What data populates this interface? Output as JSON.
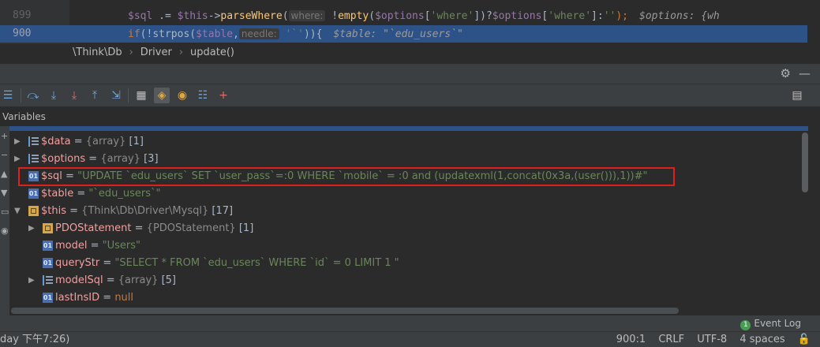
{
  "editor": {
    "lines": [
      {
        "number": "899"
      },
      {
        "number": "900"
      }
    ],
    "line899": {
      "code_a": "$sql",
      "code_b": " .= ",
      "code_c": "$this",
      "code_d": "->",
      "code_e": "parseWhere",
      "code_f": "(",
      "hint": "where:",
      "code_g": " !",
      "code_h": "empty",
      "code_i": "(",
      "code_j": "$options",
      "code_k": "[",
      "code_l": "'where'",
      "code_m": "])?",
      "code_n": "$options",
      "code_o": "[",
      "code_p": "'where'",
      "code_q": "]:",
      "code_r": "''",
      "code_s": ");",
      "inline": "$options: {wh"
    },
    "line900": {
      "code_a": "if",
      "code_b": "(!",
      "code_c": "strpos",
      "code_d": "(",
      "code_e": "$table",
      "code_f": ",",
      "hint": "needle:",
      "code_g": " '`'",
      "code_h": ")){",
      "inline": "$table: \"`edu_users`\""
    }
  },
  "breadcrumb": {
    "items": [
      "\\Think\\Db",
      "Driver",
      "update()"
    ]
  },
  "debug": {
    "section_label": "Variables",
    "header_icons": [
      "gear-icon",
      "minimize-icon"
    ],
    "variables": [
      {
        "name": "$data",
        "type": "{array}",
        "count": "[1]"
      },
      {
        "name": "$options",
        "type": "{array}",
        "count": "[3]"
      },
      {
        "name": "$sql",
        "value": "\"UPDATE `edu_users` SET `user_pass`=:0 WHERE `mobile` = :0 and (updatexml(1,concat(0x3a,(user())),1))#\""
      },
      {
        "name": "$table",
        "value": "\"`edu_users`\""
      },
      {
        "name": "$this",
        "type": "{Think\\Db\\Driver\\Mysql}",
        "count": "[17]"
      },
      {
        "name": "PDOStatement",
        "type": "{PDOStatement}",
        "count": "[1]"
      },
      {
        "name": "model",
        "value": "\"Users\""
      },
      {
        "name": "queryStr",
        "value": "\"SELECT * FROM `edu_users` WHERE `id` = 0 LIMIT 1  \""
      },
      {
        "name": "modelSql",
        "type": "{array}",
        "count": "[5]"
      },
      {
        "name": "lastInsID",
        "value": "null"
      }
    ],
    "eq": " = "
  },
  "status": {
    "event_log_count": "1",
    "event_log": "Event Log",
    "left_text": "day 下午7:26)",
    "position": "900:1",
    "line_sep": "CRLF",
    "encoding": "UTF-8",
    "indent": "4 spaces"
  }
}
